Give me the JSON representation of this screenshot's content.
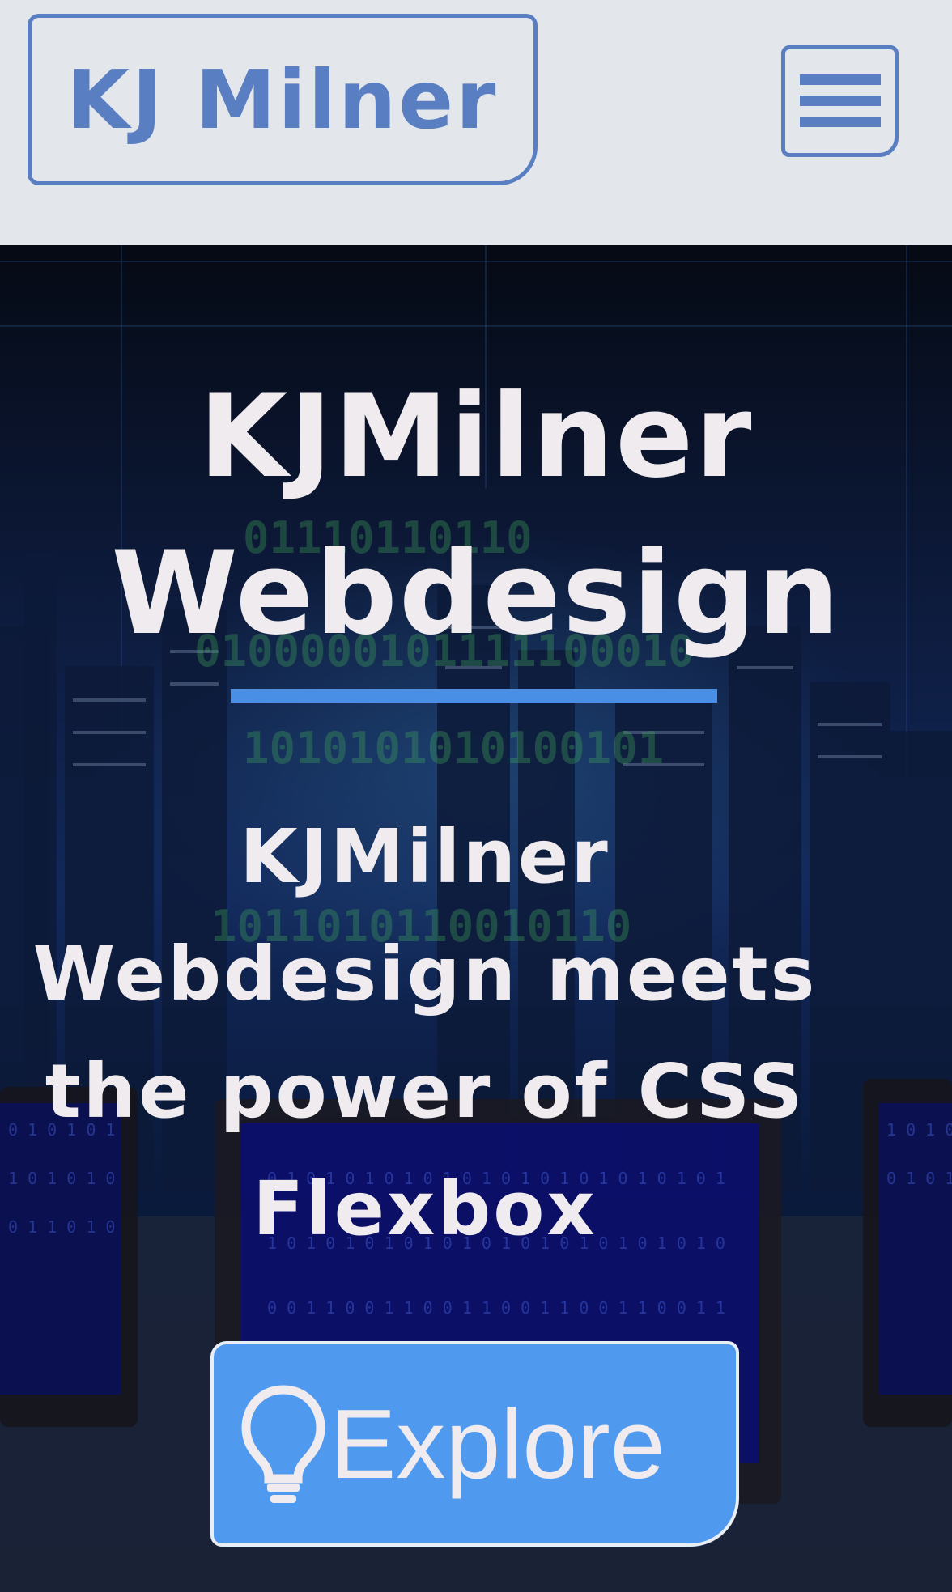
{
  "header": {
    "brand": "KJ Milner",
    "menu_icon": "hamburger-menu-icon"
  },
  "hero": {
    "title_line1": "KJMilner",
    "title_line2": "Webdesign",
    "subtitle_lines": [
      "KJMilner",
      "Webdesign meets",
      "the power of CSS",
      "Flexbox"
    ],
    "cta_label": "Explore",
    "cta_icon": "lightbulb-icon"
  },
  "colors": {
    "brand_blue": "#5a7ec2",
    "cta_blue": "#4f99ee",
    "underline_blue": "#4a8fe6",
    "text_light": "#efebee",
    "header_bg": "#e3e7ec"
  }
}
